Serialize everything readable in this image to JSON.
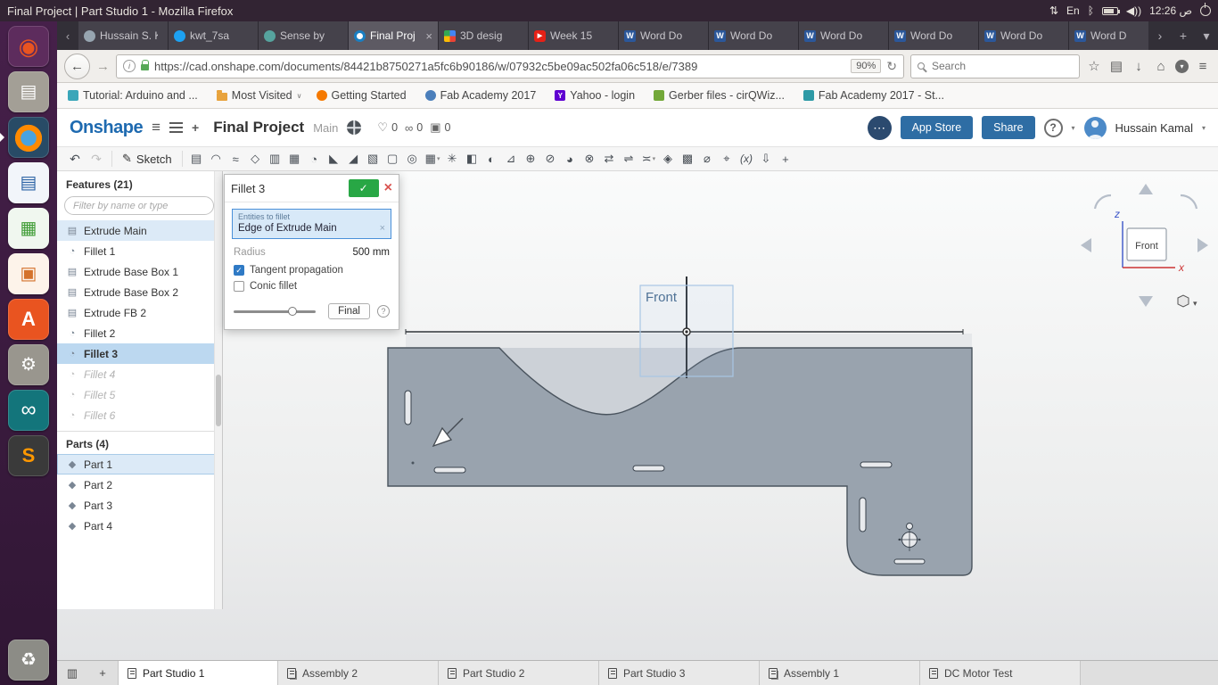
{
  "desktop": {
    "window_title": "Final Project | Part Studio 1 - Mozilla Firefox",
    "keyboard_lang": "En",
    "clock": "ص 12:26",
    "indicators": {
      "network": "⇅",
      "bluetooth": "ᛒ",
      "volume": "◀))"
    },
    "launcher": [
      {
        "name": "dash",
        "glyph": "◉"
      },
      {
        "name": "files",
        "glyph": "▤"
      },
      {
        "name": "firefox",
        "glyph": ""
      },
      {
        "name": "writer",
        "glyph": "▤"
      },
      {
        "name": "calc",
        "glyph": "▦"
      },
      {
        "name": "impress",
        "glyph": "▣"
      },
      {
        "name": "software",
        "glyph": "A"
      },
      {
        "name": "settings",
        "glyph": "⚙"
      },
      {
        "name": "arduino",
        "glyph": "∞"
      },
      {
        "name": "sublime",
        "glyph": "S"
      },
      {
        "name": "trash",
        "glyph": "♻"
      }
    ]
  },
  "browser": {
    "tab_scroll_left": "‹",
    "tab_scroll_right": "›",
    "new_tab": "+",
    "tab_list": "▾",
    "tabs": [
      {
        "name": "hussain",
        "label": "Hussain S. K",
        "icon": "person"
      },
      {
        "name": "twitter",
        "label": "kwt_7sa",
        "icon": "twitter"
      },
      {
        "name": "sense",
        "label": "Sense by",
        "icon": "sense"
      },
      {
        "name": "final-project",
        "label": "Final Proj",
        "icon": "onshape",
        "active": true,
        "close": "×"
      },
      {
        "name": "3d-design",
        "label": "3D desig",
        "icon": "grid"
      },
      {
        "name": "week-15",
        "label": "Week 15",
        "icon": "youtube",
        "fav": "▶"
      },
      {
        "name": "word-doc-1",
        "label": "Word Do",
        "icon": "word",
        "fav": "W"
      },
      {
        "name": "word-doc-2",
        "label": "Word Do",
        "icon": "word",
        "fav": "W"
      },
      {
        "name": "word-doc-3",
        "label": "Word Do",
        "icon": "word",
        "fav": "W"
      },
      {
        "name": "word-doc-4",
        "label": "Word Do",
        "icon": "word",
        "fav": "W"
      },
      {
        "name": "word-doc-5",
        "label": "Word Do",
        "icon": "word",
        "fav": "W"
      },
      {
        "name": "word-doc-6",
        "label": "Word D",
        "icon": "word",
        "fav": "W"
      }
    ],
    "icons": {
      "back": "←",
      "forward": "→",
      "info": "i",
      "reload": "↻",
      "star": "☆",
      "bookmarks": "▤",
      "downloads": "↓",
      "home": "⌂",
      "pocket": "▾",
      "menu": "≡"
    },
    "url": "https://cad.onshape.com/documents/84421b8750271a5fc6b90186/w/07932c5be09ac502fa06c518/e/7389",
    "zoom": "90%",
    "search_placeholder": "Search",
    "bookmarks": [
      {
        "name": "tutorial-arduino",
        "label": "Tutorial: Arduino and ...",
        "icon": "doc-teal"
      },
      {
        "name": "most-visited",
        "label": "Most Visited",
        "icon": "folder",
        "caret": "∨"
      },
      {
        "name": "getting-started",
        "label": "Getting Started",
        "icon": "dot-orange"
      },
      {
        "name": "fab-academy",
        "label": "Fab Academy 2017",
        "icon": "dot-globe"
      },
      {
        "name": "yahoo-login",
        "label": "Yahoo - login",
        "icon": "yahoo",
        "fav": "Y"
      },
      {
        "name": "gerber-files",
        "label": "Gerber files - cirQWiz...",
        "icon": "dot-green"
      },
      {
        "name": "fab-academy-st",
        "label": "Fab Academy 2017 - St...",
        "icon": "dot-teal2"
      }
    ]
  },
  "onshape": {
    "logo": "Onshape",
    "menu_icon": "≡",
    "document_title": "Final Project",
    "workspace": "Main",
    "counters": [
      {
        "name": "followed",
        "glyph": "♡",
        "value": "0"
      },
      {
        "name": "linked",
        "glyph": "∞",
        "value": "0"
      },
      {
        "name": "copied",
        "glyph": "▣",
        "value": "0"
      }
    ],
    "chat_glyph": "⋯",
    "app_store_label": "App Store",
    "share_label": "Share",
    "help_label": "?",
    "caret": "▾",
    "user_name": "Hussain Kamal",
    "toolbar": {
      "undo": "↶",
      "redo": "↷",
      "sketch_glyph": "✎",
      "sketch_label": "Sketch",
      "tools": [
        {
          "name": "extrude",
          "glyph": "▤"
        },
        {
          "name": "revolve",
          "glyph": "◠"
        },
        {
          "name": "sweep",
          "glyph": "≈"
        },
        {
          "name": "loft",
          "glyph": "◇"
        },
        {
          "name": "thicken",
          "glyph": "▥"
        },
        {
          "name": "enclose",
          "glyph": "▦"
        },
        {
          "name": "fillet",
          "glyph": "◔"
        },
        {
          "name": "chamfer",
          "glyph": "◣"
        },
        {
          "name": "draft",
          "glyph": "◢"
        },
        {
          "name": "rib",
          "glyph": "▧"
        },
        {
          "name": "shell",
          "glyph": "▢"
        },
        {
          "name": "hole",
          "glyph": "◎"
        },
        {
          "name": "linear-pattern",
          "glyph": "▦",
          "caret": "▾"
        },
        {
          "name": "circular-pattern",
          "glyph": "✳"
        },
        {
          "name": "mirror",
          "glyph": "◧"
        },
        {
          "name": "boolean",
          "glyph": "◐"
        },
        {
          "name": "split",
          "glyph": "⊿"
        },
        {
          "name": "transform",
          "glyph": "⊕"
        },
        {
          "name": "delete-part",
          "glyph": "⊘"
        },
        {
          "name": "modify-fillet",
          "glyph": "◕"
        },
        {
          "name": "delete-face",
          "glyph": "⊗"
        },
        {
          "name": "move-face",
          "glyph": "⇄"
        },
        {
          "name": "replace-face",
          "glyph": "⇌"
        },
        {
          "name": "offset-surface",
          "glyph": "≍",
          "caret": "▾"
        },
        {
          "name": "boundary-surface",
          "glyph": "◈"
        },
        {
          "name": "fill-surface",
          "glyph": "▩"
        },
        {
          "name": "measure",
          "glyph": "⌀"
        },
        {
          "name": "mass-properties",
          "glyph": "⌖"
        },
        {
          "name": "variables",
          "glyph": "(x)"
        },
        {
          "name": "import",
          "glyph": "⇩"
        },
        {
          "name": "custom-feature",
          "glyph": "+"
        }
      ]
    },
    "features": {
      "title": "Features (21)",
      "filter_placeholder": "Filter by name or type",
      "items": [
        {
          "label": "Extrude Main",
          "glyph": "▤",
          "state": "highlight"
        },
        {
          "label": "Fillet 1",
          "glyph": "◔"
        },
        {
          "label": "Extrude Base Box 1",
          "glyph": "▤"
        },
        {
          "label": "Extrude Base Box 2",
          "glyph": "▤"
        },
        {
          "label": "Extrude FB 2",
          "glyph": "▤"
        },
        {
          "label": "Fillet 2",
          "glyph": "◔"
        },
        {
          "label": "Fillet 3",
          "glyph": "◔",
          "state": "selected"
        },
        {
          "label": "Fillet 4",
          "glyph": "◔",
          "state": "suppressed"
        },
        {
          "label": "Fillet 5",
          "glyph": "◔",
          "state": "suppressed"
        },
        {
          "label": "Fillet 6",
          "glyph": "◔",
          "state": "suppressed"
        }
      ],
      "parts_title": "Parts (4)",
      "parts": [
        {
          "label": "Part 1",
          "glyph": "◆",
          "state": "highlight"
        },
        {
          "label": "Part 2",
          "glyph": "◆"
        },
        {
          "label": "Part 3",
          "glyph": "◆"
        },
        {
          "label": "Part 4",
          "glyph": "◆"
        }
      ]
    },
    "dialog": {
      "title": "Fillet 3",
      "confirm": "✓",
      "close": "×",
      "entities_label": "Entities to fillet",
      "entities_value": "Edge of Extrude Main",
      "entities_remove": "×",
      "radius_label": "Radius",
      "radius_value": "500 mm",
      "check_glyph": "✓",
      "tangent_label": "Tangent propagation",
      "conic_label": "Conic fillet",
      "final_label": "Final",
      "help": "?"
    },
    "canvas": {
      "plane_label": "Front",
      "cube_face": "Front",
      "axis_z": "z",
      "axis_x": "x",
      "cube_caret": "▾"
    },
    "bottom": {
      "manage_glyph": "▥",
      "add_glyph": "+",
      "tabs": [
        {
          "name": "part-studio-1",
          "label": "Part Studio 1",
          "type": "partstudio",
          "active": true
        },
        {
          "name": "assembly-2",
          "label": "Assembly 2",
          "type": "assembly"
        },
        {
          "name": "part-studio-2",
          "label": "Part Studio 2",
          "type": "partstudio"
        },
        {
          "name": "part-studio-3",
          "label": "Part Studio 3",
          "type": "partstudio"
        },
        {
          "name": "assembly-1",
          "label": "Assembly 1",
          "type": "assembly"
        },
        {
          "name": "dc-motor-test",
          "label": "DC Motor Test",
          "type": "partstudio"
        }
      ]
    }
  }
}
